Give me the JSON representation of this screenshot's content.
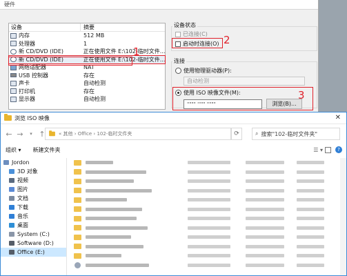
{
  "vm": {
    "title": "硬件",
    "device_col": "设备",
    "summary_col": "摘要",
    "devices": [
      {
        "name": "内存",
        "summary": "512 MB",
        "icon": "memory-icon"
      },
      {
        "name": "处理器",
        "summary": "1",
        "icon": "cpu-icon"
      },
      {
        "name": "新 CD/DVD (IDE)",
        "summary": "正在使用文件 E:\\102-临时文件...",
        "icon": "disc-icon"
      },
      {
        "name": "新 CD/DVD (IDE)",
        "summary": "正在使用文件 E:\\102-临时文件...",
        "icon": "disc-icon",
        "selected": true
      },
      {
        "name": "网络适配器",
        "summary": "NAT",
        "icon": "network-icon"
      },
      {
        "name": "USB 控制器",
        "summary": "存在",
        "icon": "usb-icon"
      },
      {
        "name": "声卡",
        "summary": "自动检测",
        "icon": "sound-icon"
      },
      {
        "name": "打印机",
        "summary": "存在",
        "icon": "printer-icon"
      },
      {
        "name": "显示器",
        "summary": "自动检测",
        "icon": "display-icon"
      }
    ],
    "device_status_label": "设备状态",
    "connected_label": "已连接(C)",
    "connect_on_power_label": "启动时连接(O)",
    "connection_label": "连接",
    "physical_drive_label": "使用物理驱动器(P):",
    "auto_detect": "自动检测",
    "iso_label": "使用 ISO 映像文件(M):",
    "iso_path": "\"\"\"\" '\"\"\" \"\"\"\"",
    "browse_label": "浏览(B)...",
    "markers": [
      "1",
      "2",
      "3"
    ],
    "marker_color": "#e0202a"
  },
  "dialog": {
    "title": "浏览 ISO 映像",
    "close": "✕",
    "breadcrumb": "« 其他 › Office › 102-临时文件夹",
    "search_placeholder": "搜索\"102-临时文件夹\"",
    "organize": "组织 ▾",
    "new_folder": "新建文件夹",
    "nav": [
      {
        "label": "Jordon",
        "level": 0,
        "color": "#6c8ebf"
      },
      {
        "label": "3D 对象",
        "level": 1,
        "color": "#4a90d9"
      },
      {
        "label": "视频",
        "level": 1,
        "color": "#5a6a80"
      },
      {
        "label": "图片",
        "level": 1,
        "color": "#5a8ad6"
      },
      {
        "label": "文档",
        "level": 1,
        "color": "#7a8aa0"
      },
      {
        "label": "下载",
        "level": 1,
        "color": "#2f7fd6"
      },
      {
        "label": "音乐",
        "level": 1,
        "color": "#2f7fd6"
      },
      {
        "label": "桌面",
        "level": 1,
        "color": "#2f8fd6"
      },
      {
        "label": "System (C:)",
        "level": 1,
        "color": "#8a96a8"
      },
      {
        "label": "Software (D:)",
        "level": 1,
        "color": "#555d68"
      },
      {
        "label": "Office (E:)",
        "level": 1,
        "color": "#555d68",
        "selected": true
      }
    ],
    "accent_color": "#3a8ad6"
  }
}
